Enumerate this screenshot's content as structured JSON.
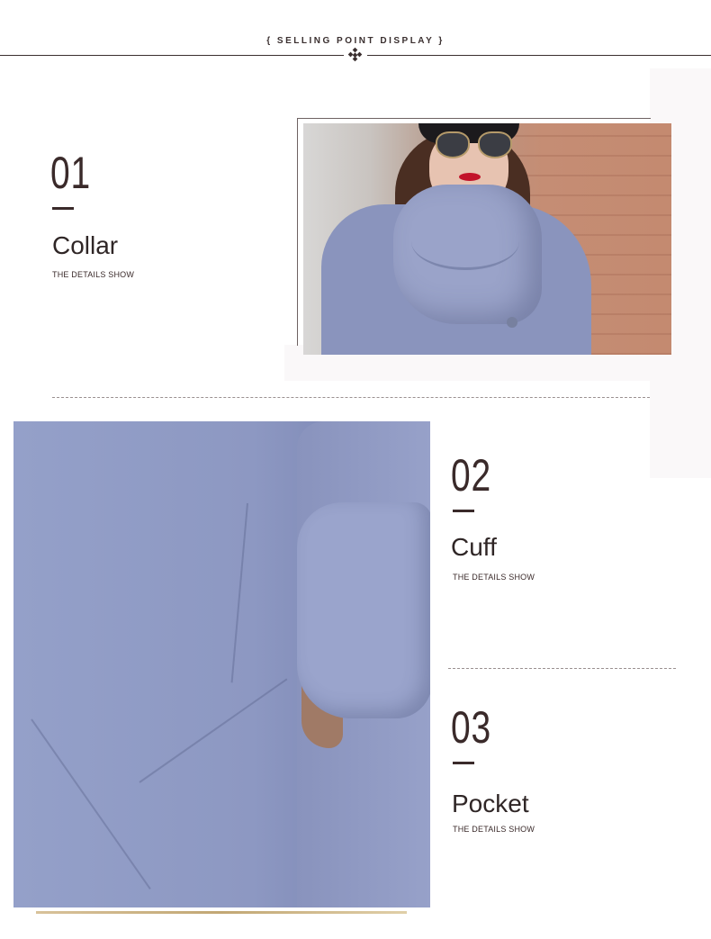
{
  "header": {
    "title": "{ SELLING POINT DISPLAY }"
  },
  "sections": [
    {
      "number": "01",
      "title": "Collar",
      "subtitle": "THE DETAILS SHOW"
    },
    {
      "number": "02",
      "title": "Cuff",
      "subtitle": "THE DETAILS SHOW"
    },
    {
      "number": "03",
      "title": "Pocket",
      "subtitle": "THE DETAILS SHOW"
    }
  ],
  "colors": {
    "text": "#3a2a2a",
    "coat_blue": "#8e98c3",
    "accent_gold": "#c2a774"
  },
  "icons": {
    "header_ornament": "diamond-ornament-icon"
  }
}
